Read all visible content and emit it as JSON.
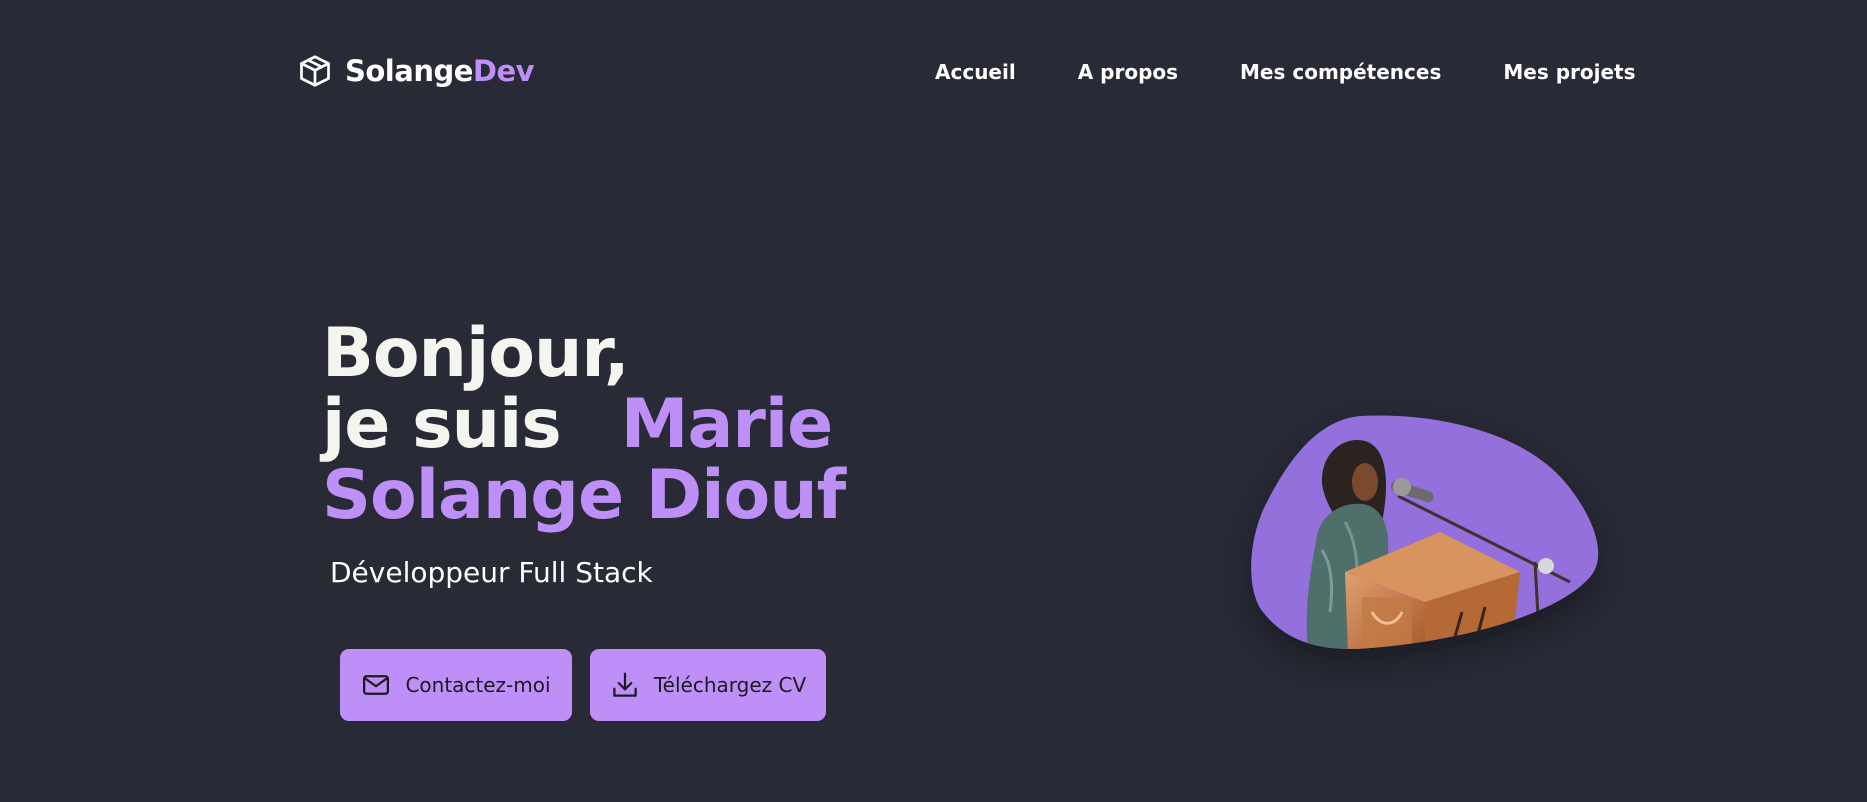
{
  "brand": {
    "name_primary": "Solange",
    "name_accent": "Dev",
    "icon": "cube-icon"
  },
  "nav": {
    "items": [
      {
        "label": "Accueil"
      },
      {
        "label": "A propos"
      },
      {
        "label": "Mes compétences"
      },
      {
        "label": "Mes projets"
      }
    ]
  },
  "hero": {
    "greeting": "Bonjour,",
    "intro": "je suis",
    "name_first": "Marie",
    "name_rest": "Solange Diouf",
    "role": "Développeur Full Stack"
  },
  "actions": {
    "contact": {
      "label": "Contactez-moi",
      "icon": "mail-icon"
    },
    "cv": {
      "label": "Téléchargez CV",
      "icon": "download-icon"
    }
  },
  "portrait": {
    "icon": "profile-photo"
  },
  "colors": {
    "background": "#282a36",
    "accent": "#bf8ff8",
    "blob": "#9370db",
    "text": "#f5f5f0"
  }
}
